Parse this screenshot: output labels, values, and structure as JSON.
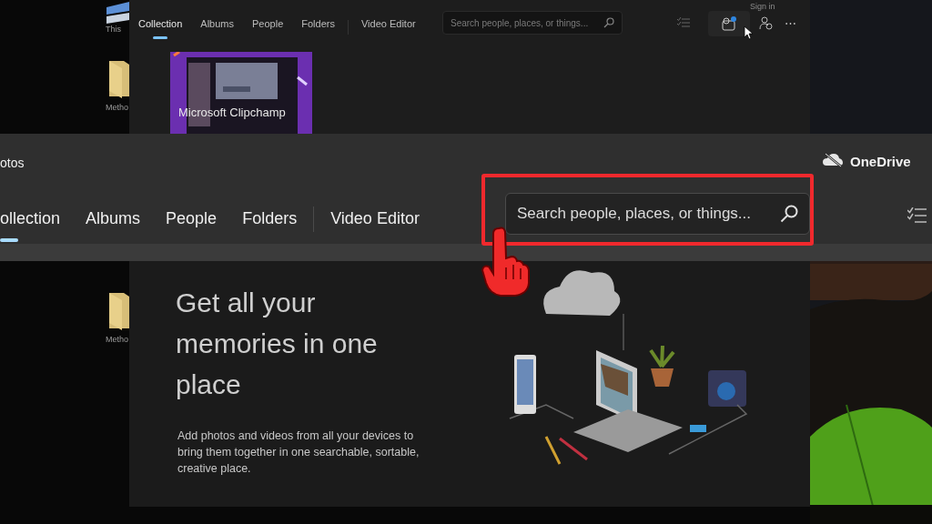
{
  "desktop": {
    "icons": [
      {
        "label": "This"
      },
      {
        "label": "Metho"
      },
      {
        "label": "Metho"
      }
    ]
  },
  "back_window": {
    "tabs": [
      {
        "label": "Collection",
        "selected": true
      },
      {
        "label": "Albums",
        "selected": false
      },
      {
        "label": "People",
        "selected": false
      },
      {
        "label": "Folders",
        "selected": false
      },
      {
        "label": "Video Editor",
        "selected": false
      }
    ],
    "search": {
      "placeholder": "Search people, places, or things..."
    },
    "tooltip": "Sign in",
    "more_button": "⋯",
    "tile": {
      "title": "Microsoft Clipchamp"
    }
  },
  "zoomed_view": {
    "title": "otos",
    "cloud_label": "OneDrive",
    "tabs": [
      {
        "label": "ollection",
        "selected": true
      },
      {
        "label": "Albums",
        "selected": false
      },
      {
        "label": "People",
        "selected": false
      },
      {
        "label": "Folders",
        "selected": false
      },
      {
        "label": "Video Editor",
        "selected": false
      }
    ],
    "search": {
      "placeholder": "Search people, places, or things...",
      "highlighted": true
    }
  },
  "content": {
    "heading": "Get all your memories in one place",
    "description": "Add photos and videos from all your devices to bring them together in one searchable, sortable, creative place."
  }
}
